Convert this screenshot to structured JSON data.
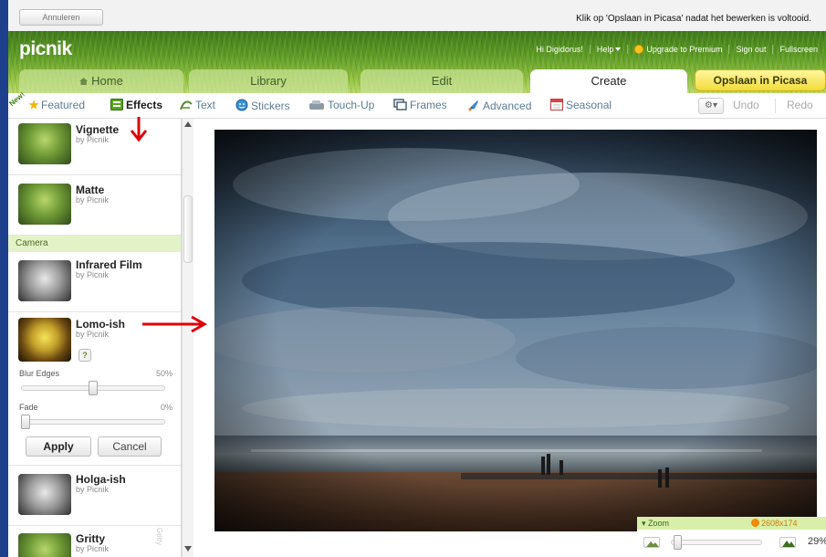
{
  "topbar": {
    "cancel_label": "Annuleren",
    "message": "Klik op 'Opslaan in Picasa' nadat het bewerken is voltooid."
  },
  "header": {
    "logo": "picnik",
    "links": [
      "Hi Digidorus!",
      "Help",
      "Upgrade to Premium",
      "Sign out",
      "Fullscreen"
    ],
    "tabs": [
      {
        "label": "Home",
        "active": false
      },
      {
        "label": "Library",
        "active": false
      },
      {
        "label": "Edit",
        "active": false
      },
      {
        "label": "Create",
        "active": true
      }
    ],
    "save_label": "Opslaan in Picasa"
  },
  "toolbar": {
    "new_badge": "New!",
    "items": [
      "Featured",
      "Effects",
      "Text",
      "Stickers",
      "Touch-Up",
      "Frames",
      "Advanced",
      "Seasonal"
    ],
    "active_item": "Effects",
    "gear_label": "⚙▾",
    "undo": "Undo",
    "redo": "Redo"
  },
  "effects": {
    "byline": "by Picnik",
    "section_camera": "Camera",
    "items": [
      {
        "name": "Vignette"
      },
      {
        "name": "Matte"
      },
      {
        "name": "Infrared Film"
      },
      {
        "name": "Lomo-ish",
        "expanded": true
      },
      {
        "name": "Holga-ish"
      },
      {
        "name": "Gritty"
      }
    ],
    "help_label": "?",
    "sliders": [
      {
        "label": "Blur Edges",
        "value": "50%",
        "level": 0.5
      },
      {
        "label": "Fade",
        "value": "0%",
        "level": 0.0
      }
    ],
    "apply_label": "Apply",
    "cancel_label": "Cancel",
    "side_tag": "Gritty"
  },
  "zoom": {
    "label": "Zoom",
    "dimensions": "2608x174",
    "percent": "29%",
    "level": 0.02
  },
  "colors": {
    "brand_green": "#5e9c24",
    "accent_yellow": "#f1dc3a",
    "link_blue": "#5b7c93",
    "annotation_red": "#e0000a"
  }
}
